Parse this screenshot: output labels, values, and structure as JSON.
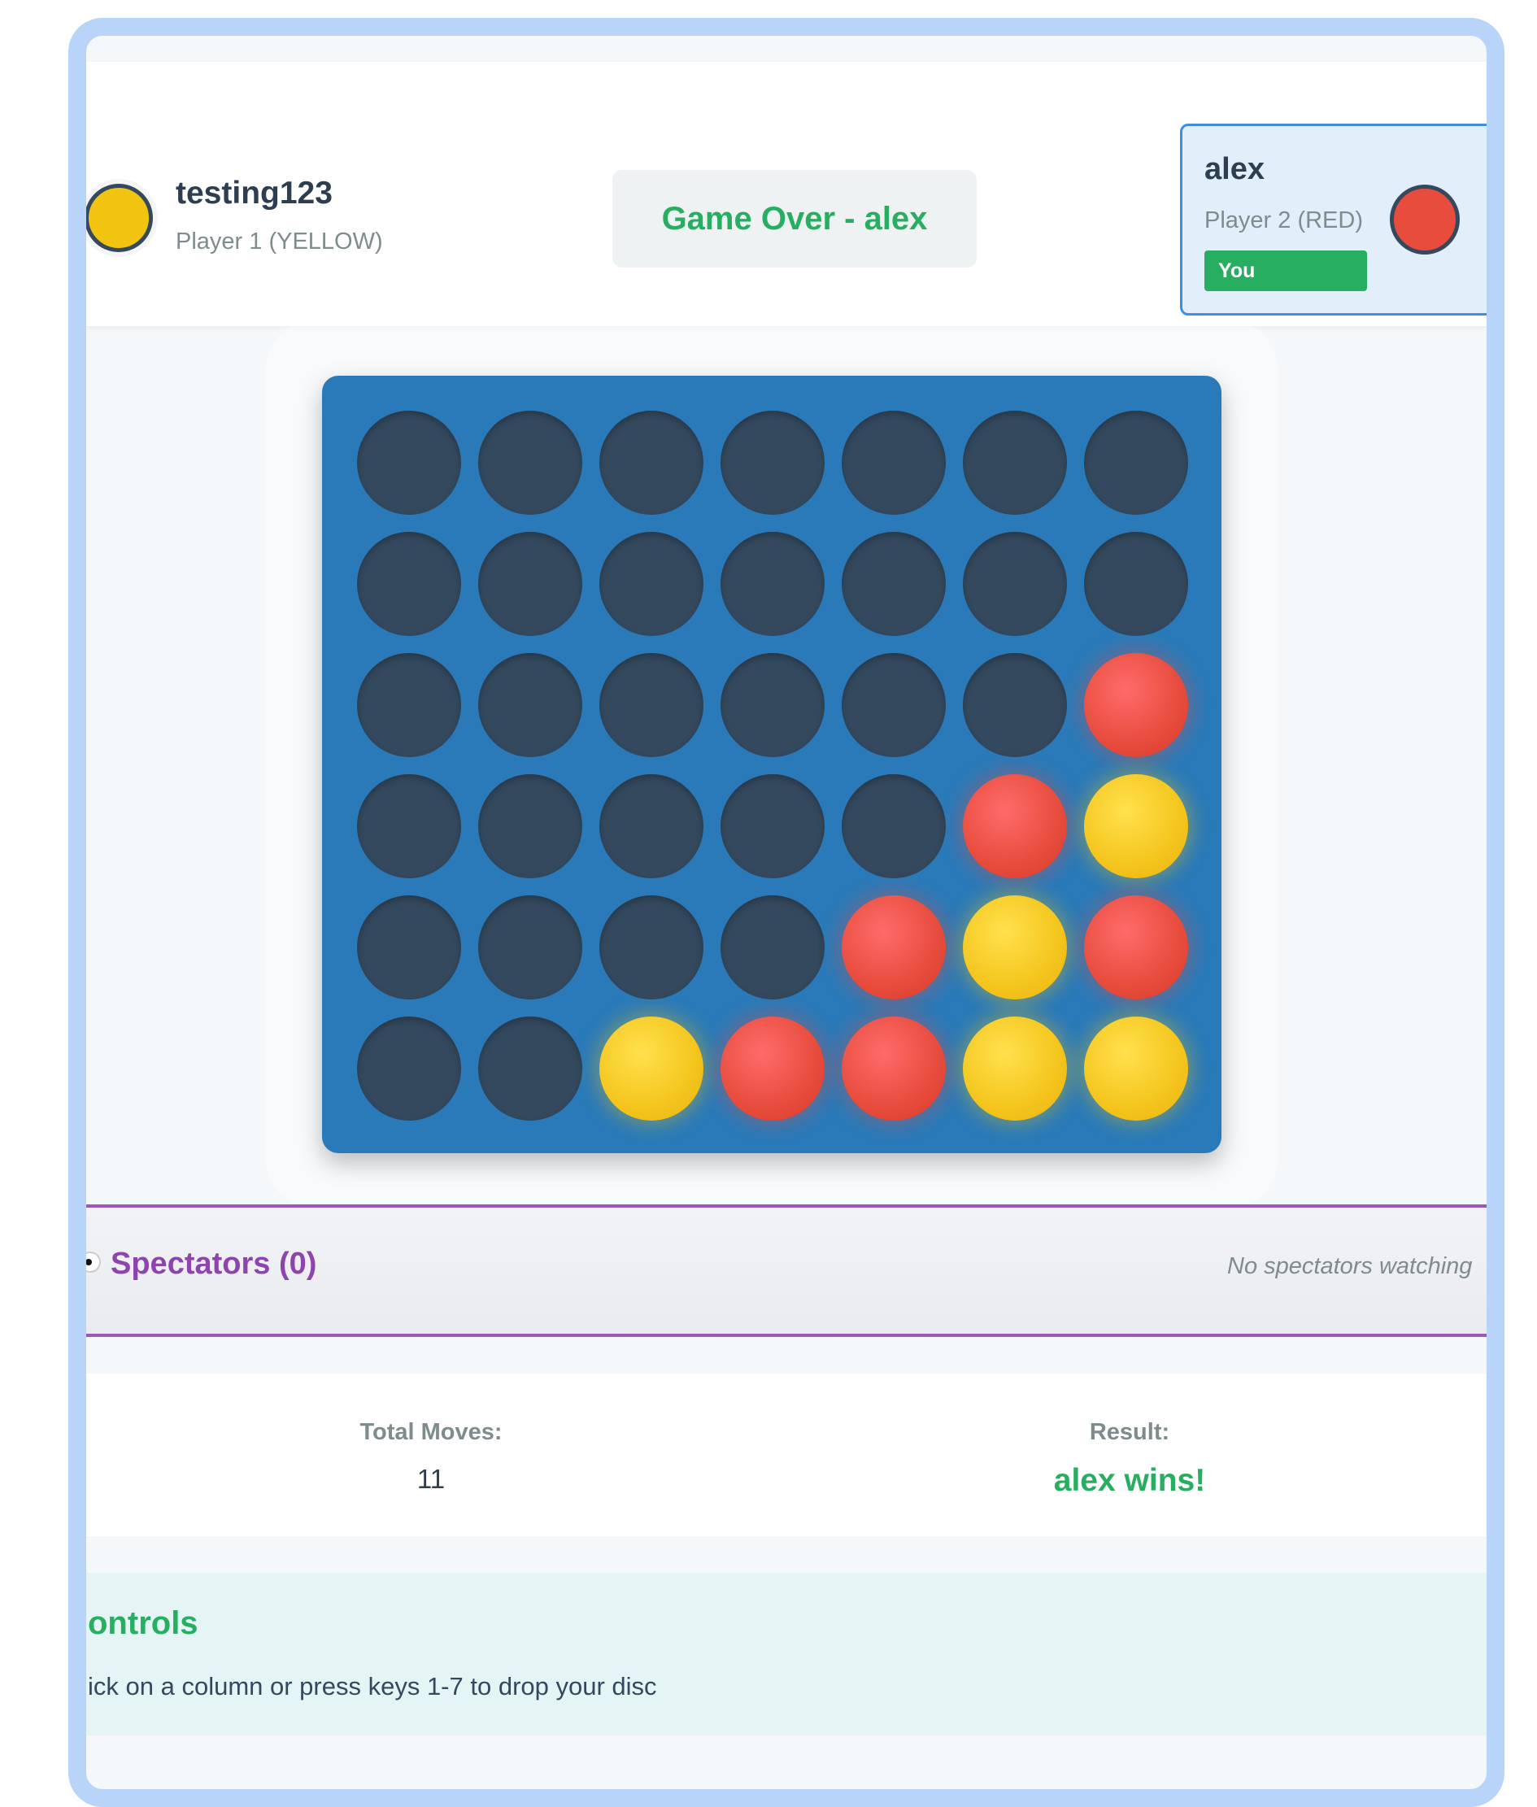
{
  "player1": {
    "name": "testing123",
    "role": "Player 1 (YELLOW)",
    "color": "#f1c40f"
  },
  "status": {
    "text": "Game Over - alex"
  },
  "player2": {
    "name": "alex",
    "role": "Player 2 (RED)",
    "badge": "You",
    "color": "#e74c3c"
  },
  "board": {
    "rows": 6,
    "cols": 7,
    "cells": [
      [
        "empty",
        "empty",
        "empty",
        "empty",
        "empty",
        "empty",
        "empty"
      ],
      [
        "empty",
        "empty",
        "empty",
        "empty",
        "empty",
        "empty",
        "empty"
      ],
      [
        "empty",
        "empty",
        "empty",
        "empty",
        "empty",
        "empty",
        "red"
      ],
      [
        "empty",
        "empty",
        "empty",
        "empty",
        "empty",
        "red",
        "yellow"
      ],
      [
        "empty",
        "empty",
        "empty",
        "empty",
        "red",
        "yellow",
        "red"
      ],
      [
        "empty",
        "empty",
        "yellow",
        "red",
        "red",
        "yellow",
        "yellow"
      ]
    ]
  },
  "spectators": {
    "title": "Spectators (0)",
    "empty_text": "No spectators watching"
  },
  "stats": {
    "moves_label": "Total Moves:",
    "moves_value": "11",
    "result_label": "Result:",
    "result_value": "alex wins!"
  },
  "controls": {
    "title": "ontrols",
    "text": "ick on a column or press keys 1-7 to drop your disc"
  }
}
